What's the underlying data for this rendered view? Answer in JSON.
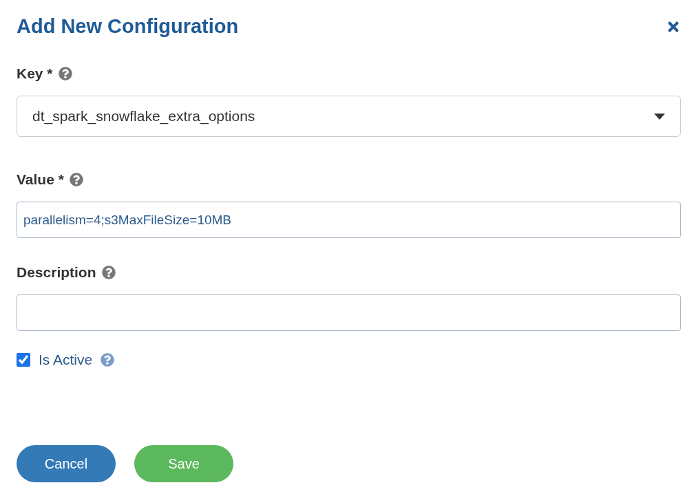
{
  "dialog": {
    "title": "Add New Configuration"
  },
  "fields": [
    {
      "kind": "select",
      "label": "Key *",
      "value": "dt_spark_snowflake_extra_options"
    },
    {
      "kind": "input",
      "label": "Value *",
      "value": "parallelism=4;s3MaxFileSize=10MB"
    },
    {
      "kind": "input",
      "label": "Description"
    }
  ],
  "active": {
    "label": "Is Active",
    "checked": true
  },
  "buttons": [
    {
      "kind": "primary",
      "label": "Cancel"
    },
    {
      "kind": "success",
      "label": "Save"
    }
  ]
}
